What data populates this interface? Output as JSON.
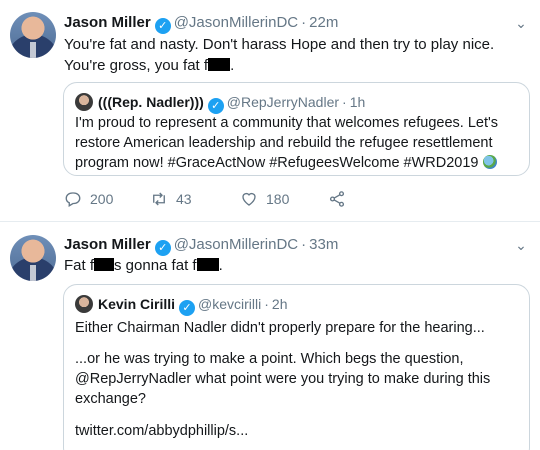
{
  "tweets": [
    {
      "author_name": "Jason Miller",
      "handle": "@JasonMillerinDC",
      "separator": "·",
      "time": "22m",
      "text_part1": "You're fat and nasty. Don't harass Hope and then try to play nice. You're gross, you fat f",
      "text_part2": ".",
      "quoted": {
        "author_name": "(((Rep. Nadler)))",
        "handle": "@RepJerryNadler",
        "time": "1h",
        "text": "I'm proud to represent a community that welcomes refugees. Let's restore American leadership and rebuild the refugee resettlement program now! #GraceActNow #RefugeesWelcome #WRD2019"
      },
      "actions": {
        "replies": "200",
        "retweets": "43",
        "likes": "180"
      }
    },
    {
      "author_name": "Jason Miller",
      "handle": "@JasonMillerinDC",
      "separator": "·",
      "time": "33m",
      "text_part1": "Fat f",
      "text_part2": "s gonna fat f",
      "text_part3": ".",
      "quoted": {
        "author_name": "Kevin Cirilli",
        "handle": "@kevcirilli",
        "time": "2h",
        "paragraph1": "Either Chairman Nadler didn't properly prepare for the hearing...",
        "paragraph2": "...or he was trying to make a point. Which begs the question, @RepJerryNadler what point were you trying to make during this exchange?",
        "paragraph3": "twitter.com/abbydphillip/s..."
      }
    }
  ],
  "colors": {
    "verified": "#1da1f2",
    "secondary_text": "#657786",
    "border": "#ccd6dd"
  },
  "icons": [
    "verified-badge-icon",
    "chevron-down-icon",
    "reply-icon",
    "retweet-icon",
    "like-icon",
    "share-icon",
    "globe-emoji-icon"
  ]
}
